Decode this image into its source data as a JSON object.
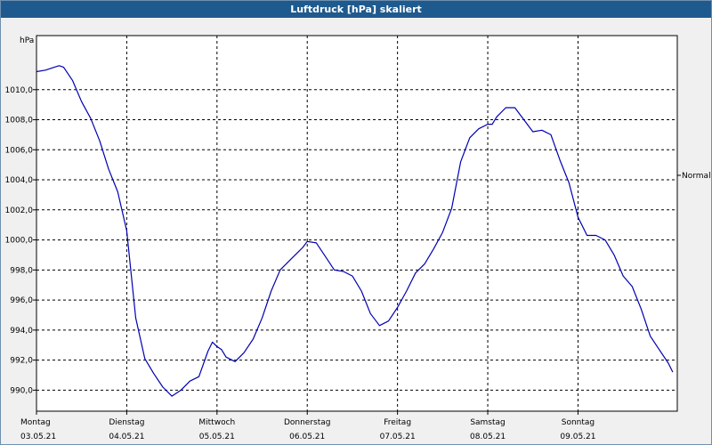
{
  "window": {
    "title": "Luftdruck [hPa] skaliert"
  },
  "colors": {
    "line": "#0000b0",
    "grid": "#000000",
    "title_bar": "#1e5a8e",
    "background": "#ffffff"
  },
  "chart_data": {
    "type": "line",
    "title": "Luftdruck [hPa] skaliert",
    "ylabel": "hPa",
    "right_label": "Normal",
    "ylim": [
      988.6,
      1013.6
    ],
    "yticks": [
      990,
      992,
      994,
      996,
      998,
      1000,
      1002,
      1004,
      1006,
      1008,
      1010
    ],
    "ytick_labels": [
      "990,0",
      "992,0",
      "994,0",
      "996,0",
      "998,0",
      "1000,0",
      "1002,0",
      "1004,0",
      "1006,0",
      "1008,0",
      "1010,0"
    ],
    "normal_level": 1004.3,
    "x_unit": "days since 03.05.21 00:00",
    "xlim": [
      0,
      7.1
    ],
    "xticks": [
      {
        "x": 0,
        "day": "Montag",
        "date": "03.05.21"
      },
      {
        "x": 1,
        "day": "Dienstag",
        "date": "04.05.21"
      },
      {
        "x": 2,
        "day": "Mittwoch",
        "date": "05.05.21"
      },
      {
        "x": 3,
        "day": "Donnerstag",
        "date": "06.05.21"
      },
      {
        "x": 4,
        "day": "Freitag",
        "date": "07.05.21"
      },
      {
        "x": 5,
        "day": "Samstag",
        "date": "08.05.21"
      },
      {
        "x": 6,
        "day": "Sonntag",
        "date": "09.05.21"
      }
    ],
    "grid": true,
    "series": [
      {
        "name": "Luftdruck",
        "x": [
          0,
          0.1,
          0.2,
          0.25,
          0.3,
          0.4,
          0.5,
          0.6,
          0.7,
          0.8,
          0.9,
          1.0,
          1.1,
          1.2,
          1.3,
          1.4,
          1.5,
          1.6,
          1.7,
          1.8,
          1.9,
          1.95,
          2.0,
          2.05,
          2.1,
          2.2,
          2.3,
          2.4,
          2.5,
          2.6,
          2.7,
          2.8,
          2.9,
          2.95,
          3.0,
          3.1,
          3.2,
          3.3,
          3.4,
          3.5,
          3.6,
          3.7,
          3.8,
          3.9,
          4.0,
          4.1,
          4.2,
          4.3,
          4.4,
          4.5,
          4.6,
          4.7,
          4.8,
          4.9,
          5.0,
          5.05,
          5.1,
          5.2,
          5.3,
          5.4,
          5.5,
          5.6,
          5.7,
          5.8,
          5.9,
          6.0,
          6.1,
          6.2,
          6.3,
          6.4,
          6.5,
          6.6,
          6.7,
          6.8,
          6.9,
          7.0,
          7.05
        ],
        "y": [
          1011.2,
          1011.3,
          1011.5,
          1011.6,
          1011.5,
          1010.6,
          1009.2,
          1008.1,
          1006.6,
          1004.7,
          1003.2,
          1000.6,
          994.8,
          992.1,
          991.1,
          990.2,
          989.6,
          990.0,
          990.6,
          990.9,
          992.6,
          993.2,
          992.9,
          992.7,
          992.2,
          991.9,
          992.5,
          993.4,
          994.8,
          996.6,
          998.0,
          998.6,
          999.2,
          999.5,
          999.9,
          999.8,
          998.9,
          998.0,
          997.9,
          997.6,
          996.6,
          995.1,
          994.3,
          994.6,
          995.5,
          996.6,
          997.8,
          998.4,
          999.4,
          1000.5,
          1002.1,
          1005.2,
          1006.8,
          1007.4,
          1007.7,
          1007.7,
          1008.2,
          1008.8,
          1008.8,
          1008.0,
          1007.2,
          1007.3,
          1007.0,
          1005.3,
          1003.8,
          1001.5,
          1000.3,
          1000.3,
          1000.0,
          999.0,
          997.6,
          996.9,
          995.4,
          993.6,
          992.7,
          991.8,
          991.2
        ]
      }
    ]
  }
}
